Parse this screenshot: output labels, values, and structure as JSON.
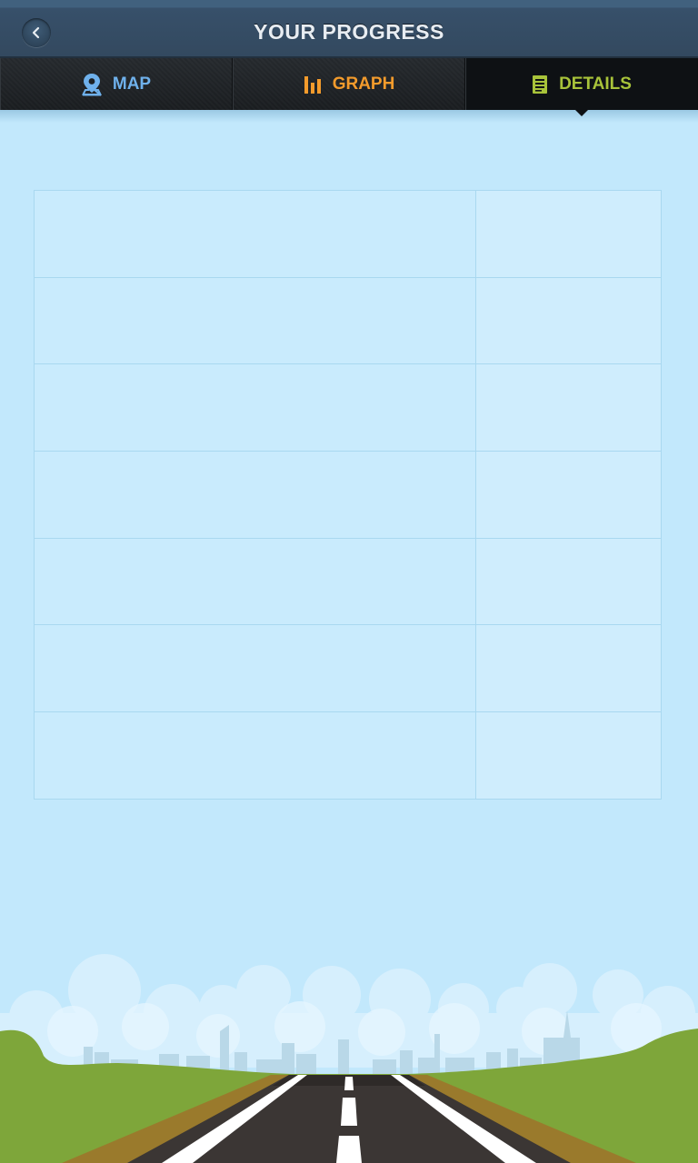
{
  "header": {
    "title": "YOUR PROGRESS"
  },
  "tabs": [
    {
      "label": "MAP",
      "icon": "map-pin-icon",
      "color": "#6fb1ec",
      "active": false
    },
    {
      "label": "GRAPH",
      "icon": "bar-chart-icon",
      "color": "#f39b2c",
      "active": false
    },
    {
      "label": "DETAILS",
      "icon": "document-list-icon",
      "color": "#a8c33a",
      "active": true
    }
  ],
  "details": {
    "rows": [
      {
        "label": "",
        "value": ""
      },
      {
        "label": "",
        "value": ""
      },
      {
        "label": "",
        "value": ""
      },
      {
        "label": "",
        "value": ""
      },
      {
        "label": "",
        "value": ""
      },
      {
        "label": "",
        "value": ""
      },
      {
        "label": "",
        "value": ""
      }
    ]
  },
  "colors": {
    "sky": "#c2e8fc",
    "header": "#33495f",
    "grass": "#7ea63a",
    "road": "#3b3634"
  }
}
